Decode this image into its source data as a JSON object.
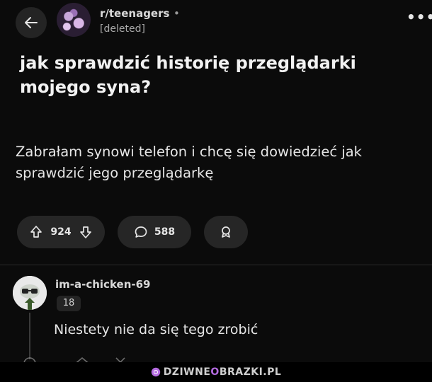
{
  "header": {
    "subreddit": "r/teenagers",
    "separator": "•",
    "username": "[deleted]",
    "more": "•••"
  },
  "post": {
    "title": "jak sprawdzić historię przeglądarki mojego syna?",
    "body": "Zabrałam synowi telefon i chcę się dowiedzieć jak sprawdzić jego przeglądarkę",
    "upvotes": "924",
    "comments": "588"
  },
  "comment": {
    "author": "im-a-chicken-69",
    "badge": "18",
    "text": "Niestety nie da się tego zrobić"
  },
  "watermark": {
    "prefix": "DZIWNE",
    "highlight": "O",
    "suffix": "BRAZKI.PL"
  },
  "colors": {
    "background": "#0b0b0b",
    "pill": "#262626",
    "watermark_accent": "#b46be0"
  },
  "icons": [
    "back-arrow-icon",
    "upvote-icon",
    "downvote-icon",
    "comment-icon",
    "award-icon",
    "more-icon"
  ]
}
